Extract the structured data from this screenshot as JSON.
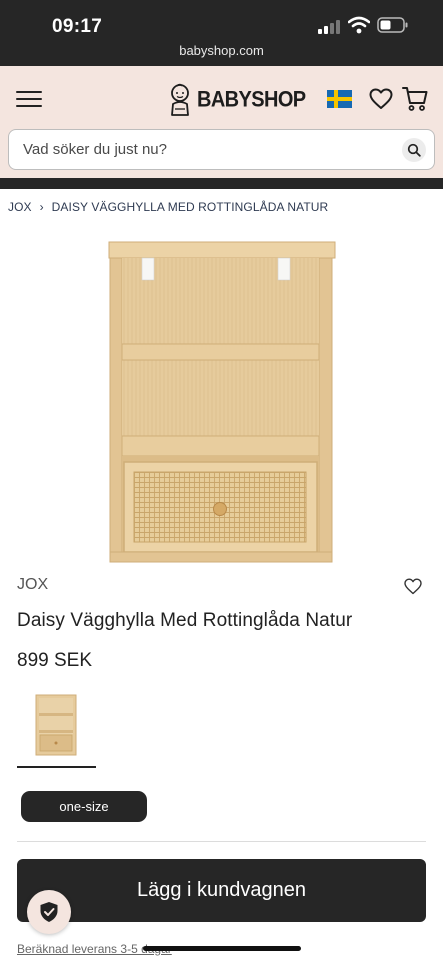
{
  "status_bar": {
    "time": "09:17",
    "url": "babyshop.com"
  },
  "header": {
    "logo_text": "BABYSHOP",
    "menu_icon": "hamburger-menu-icon",
    "flag_icon": "swedish-flag-icon",
    "wishlist_icon": "heart-icon",
    "cart_icon": "shopping-cart-icon"
  },
  "search": {
    "placeholder": "Vad söker du just nu?",
    "icon": "search-icon"
  },
  "breadcrumb": {
    "items": [
      "JOX",
      "DAISY VÄGGHYLLA MED ROTTINGLÅDA NATUR"
    ]
  },
  "product": {
    "brand": "JOX",
    "title": "Daisy Vägghylla Med Rottinglåda Natur",
    "price": "899 SEK",
    "size_label": "one-size",
    "add_to_cart_label": "Lägg i kundvagnen",
    "delivery_text": "Beräknad leverans 3-5 dagar"
  },
  "colors": {
    "header_bg": "#f4e5df",
    "dark": "#262626",
    "wood": "#e3c594"
  }
}
